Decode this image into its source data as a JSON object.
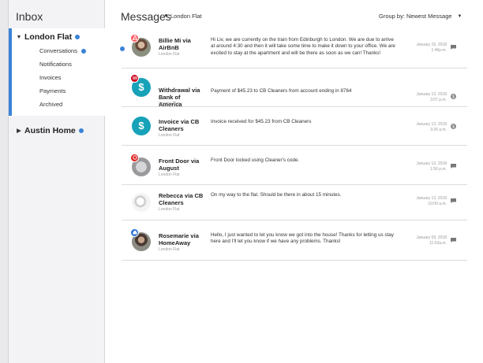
{
  "sidebar": {
    "title": "Inbox",
    "accounts": [
      {
        "name": "London Flat",
        "expanded": true,
        "items": [
          {
            "label": "Conversations",
            "unread": true
          },
          {
            "label": "Notifications",
            "unread": false
          },
          {
            "label": "Invoices",
            "unread": false
          },
          {
            "label": "Payments",
            "unread": false
          },
          {
            "label": "Archived",
            "unread": false
          }
        ]
      },
      {
        "name": "Austin Home",
        "expanded": false
      }
    ]
  },
  "header": {
    "title": "Messages",
    "subtitle": "London Flat",
    "group_by": "Group by: Newest Message"
  },
  "colors": {
    "accent": "#3b82d6",
    "dollar": "#17a2b8",
    "badge_airbnb": "#ff5a5f",
    "badge_bank": "#d0021b",
    "badge_homeaway": "#2c6fd1"
  },
  "messages": [
    {
      "sender": "Billie Mi via AirBnB",
      "place": "London Flat",
      "text": "Hi Liv, we are currently on the train from Edinburgh to London. We are due to arrive at around 4:30 and then it will take some time to make it down to your office. We are excited to stay at the apartment and will be there as soon as we can! Thanks!",
      "date": "January 15, 2018",
      "time": "1:46p.m.",
      "unread": true,
      "avatar": "photo",
      "badge": "airbnb-icon",
      "type_icon": "message-icon"
    },
    {
      "sender": "Withdrawal via Bank of America",
      "place": "London Flat",
      "text": "Payment of $45.23 to CB Cleaners from account ending in 8764",
      "date": "January 12, 2018",
      "time": "3:07 p.m.",
      "unread": false,
      "avatar": "dollar",
      "badge": "bank-icon",
      "type_icon": "payment-icon"
    },
    {
      "sender": "Invoice via CB Cleaners",
      "place": "London Flat",
      "text": "Invoice received for $45.23 from CB Cleaners",
      "date": "January 12, 2018",
      "time": "3:26 a.m.",
      "unread": false,
      "avatar": "dollar",
      "badge": "",
      "type_icon": "payment-icon"
    },
    {
      "sender": "Front Door via August",
      "place": "London Flat",
      "text": "Front Door locked using Cleaner's code.",
      "date": "January 12, 2018",
      "time": "1:56 p.m.",
      "unread": false,
      "avatar": "lock",
      "badge": "august-icon",
      "type_icon": "message-icon"
    },
    {
      "sender": "Rebecca via CB Cleaners",
      "place": "London Flat",
      "text": "On my way to the flat.  Should be there in about 15 minutes.",
      "date": "January 12, 2018",
      "time": "10:00 a.m.",
      "unread": false,
      "avatar": "sketch",
      "badge": "",
      "type_icon": "message-icon"
    },
    {
      "sender": "Rosemarie via HomeAway",
      "place": "London Flat",
      "text": "Hello, I just wanted to let you know we got into the house! Thanks for letting us stay here and I'll let you know if we have any problems. Thanks!",
      "date": "January 09, 2018",
      "time": "11:53a.m.",
      "unread": false,
      "avatar": "photo",
      "badge": "homeaway-icon",
      "type_icon": "message-icon"
    }
  ]
}
